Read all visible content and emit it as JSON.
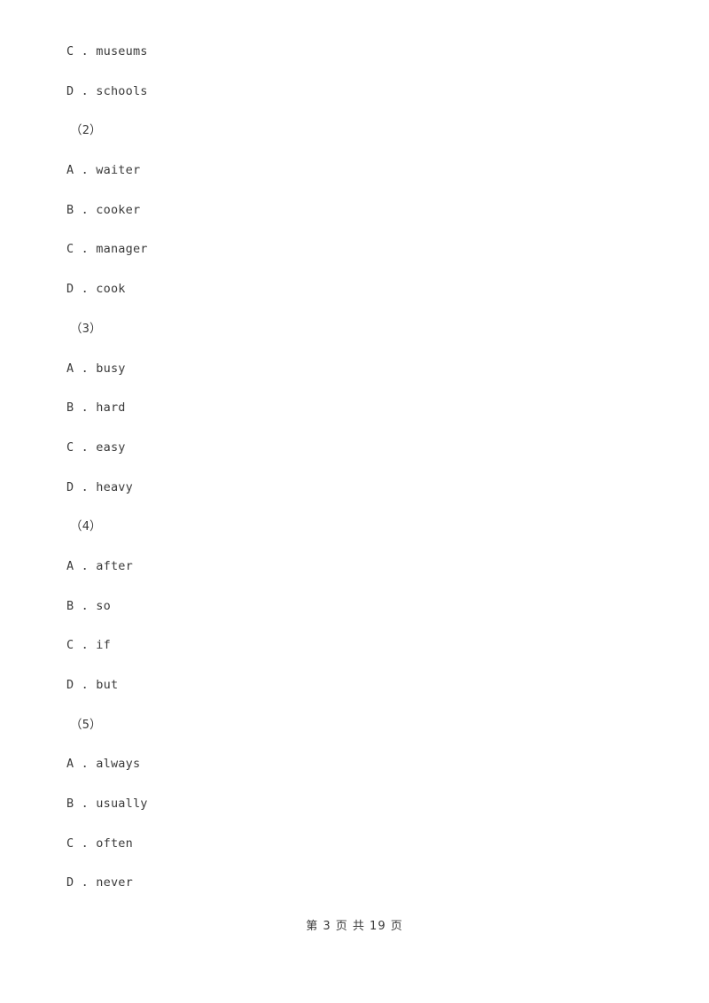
{
  "document": {
    "type": "english-exam-worksheet",
    "background_color": "#ffffff",
    "text_color": "#3a3a3a"
  },
  "blocks": [
    {
      "kind": "option",
      "text": "C . museums"
    },
    {
      "kind": "option",
      "text": "D . schools"
    },
    {
      "kind": "question",
      "text": "（2）"
    },
    {
      "kind": "option",
      "text": "A . waiter"
    },
    {
      "kind": "option",
      "text": "B . cooker"
    },
    {
      "kind": "option",
      "text": "C . manager"
    },
    {
      "kind": "option",
      "text": "D . cook"
    },
    {
      "kind": "question",
      "text": "（3）"
    },
    {
      "kind": "option",
      "text": "A . busy"
    },
    {
      "kind": "option",
      "text": "B . hard"
    },
    {
      "kind": "option",
      "text": "C . easy"
    },
    {
      "kind": "option",
      "text": "D . heavy"
    },
    {
      "kind": "question",
      "text": "（4）"
    },
    {
      "kind": "option",
      "text": "A . after"
    },
    {
      "kind": "option",
      "text": "B . so"
    },
    {
      "kind": "option",
      "text": "C . if"
    },
    {
      "kind": "option",
      "text": "D . but"
    },
    {
      "kind": "question",
      "text": "（5）"
    },
    {
      "kind": "option",
      "text": "A . always"
    },
    {
      "kind": "option",
      "text": "B . usually"
    },
    {
      "kind": "option",
      "text": "C . often"
    },
    {
      "kind": "option",
      "text": "D . never"
    }
  ],
  "footer": {
    "text": "第 3 页 共 19 页",
    "current_page": "3",
    "total_pages": "19"
  }
}
